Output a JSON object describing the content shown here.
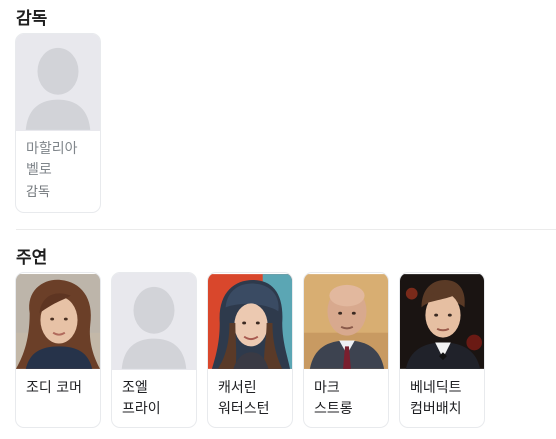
{
  "director_section": {
    "title": "감독",
    "people": [
      {
        "name": "마할리아 벨로",
        "role": "감독",
        "icon": "person-placeholder-icon"
      }
    ]
  },
  "cast_section": {
    "title": "주연",
    "people": [
      {
        "name": "조디 코머"
      },
      {
        "name": "조엘 프라이",
        "icon": "person-placeholder-icon"
      },
      {
        "name": "캐서린 워터스턴"
      },
      {
        "name": "마크 스트롱"
      },
      {
        "name": "베네딕트 컴버배치"
      }
    ]
  },
  "colors": {
    "placeholder_bg": "#e8e8ed",
    "placeholder_silhouette": "#d2d3d8",
    "card_border": "#e8eaed"
  }
}
